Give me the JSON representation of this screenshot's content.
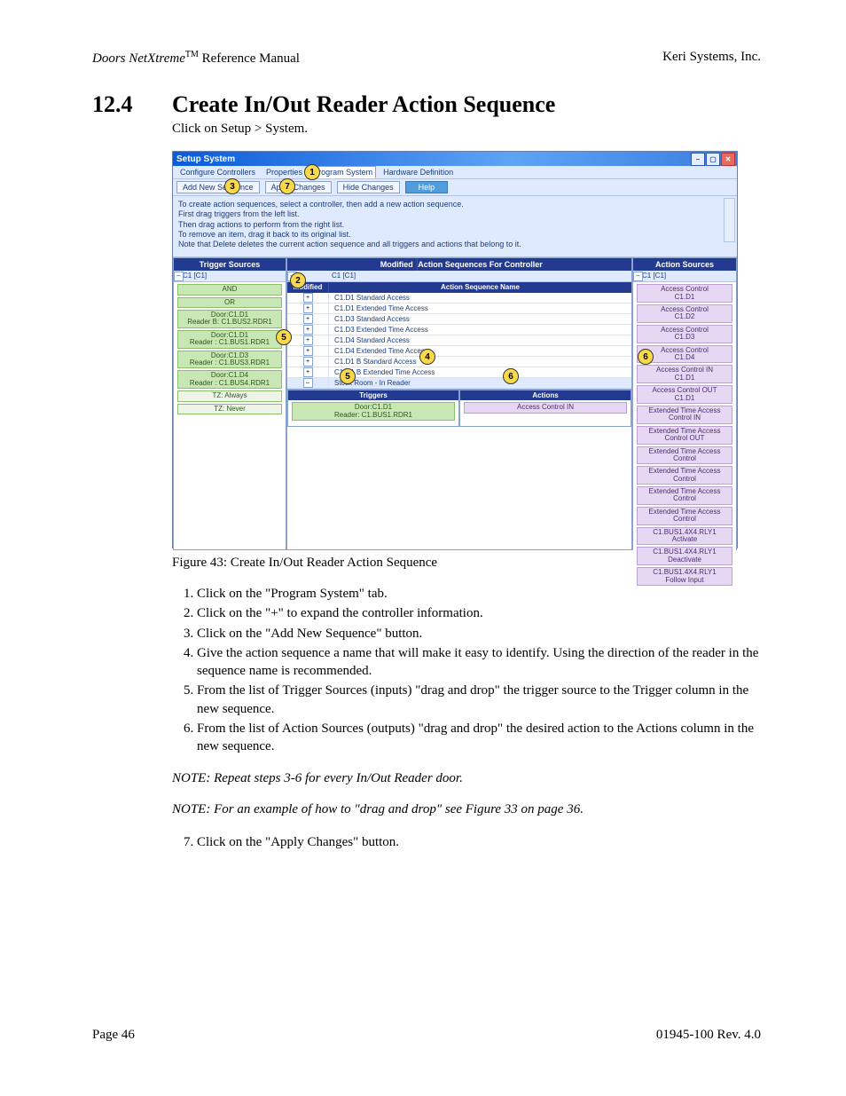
{
  "header": {
    "left_product": "Doors NetXtreme",
    "left_tm": "TM",
    "left_rest": " Reference Manual",
    "right": "Keri Systems, Inc."
  },
  "h1": {
    "num": "12.4",
    "title": "Create In/Out Reader Action Sequence"
  },
  "intro": "Click on Setup > System.",
  "fig": {
    "caption": "Figure 43: Create In/Out Reader Action Sequence"
  },
  "steps": [
    "Click on the \"Program System\" tab.",
    "Click on the \"+\" to expand the controller information.",
    "Click on the \"Add New Sequence\" button.",
    "Give the action sequence a name that will make it easy to identify. Using the direction of the reader in the sequence name is recommended.",
    "From the list of Trigger Sources (inputs) \"drag and drop\" the trigger source to the Trigger column in the new sequence.",
    "From the list of Action Sources (outputs) \"drag and drop\" the desired action to the Actions column in the new sequence."
  ],
  "note1": "NOTE: Repeat steps 3-6 for every In/Out Reader door.",
  "note2": "NOTE: For an example of how to \"drag and drop\" see Figure 33 on page 36.",
  "step7": "Click on the \"Apply Changes\" button.",
  "footer": {
    "left": "Page 46",
    "right": "01945-100  Rev. 4.0"
  },
  "shot": {
    "title": "Setup System",
    "tabs": [
      "Configure Controllers",
      "Properties",
      "Program System",
      "Hardware Definition"
    ],
    "toolbar": {
      "add": "Add New Sequence",
      "apply": "Apply Changes",
      "hide": "Hide Changes",
      "help": "Help"
    },
    "help": [
      "To create action sequences, select a controller, then add a new action sequence.",
      "First drag triggers from the left list.",
      "Then drag actions to perform from the right list.",
      "To remove an item, drag it back to its original list.",
      "Note that Delete deletes the current action sequence and all triggers and actions that belong to it."
    ],
    "left": {
      "head": "Trigger Sources",
      "ctl": "C1 [C1]",
      "items": [
        "AND",
        "OR",
        "Door:C1.D1\nReader B: C1.BUS2.RDR1",
        "Door:C1.D1\nReader : C1.BUS1.RDR1",
        "Door:C1.D3\nReader : C1.BUS3.RDR1",
        "Door:C1.D4\nReader : C1.BUS4.RDR1",
        "TZ: Always",
        "TZ: Never"
      ]
    },
    "mid": {
      "head": "Action Sequences For Controller",
      "ctl": "C1 [C1]",
      "cols": {
        "m": "Modified",
        "r": "Action Sequence Name"
      },
      "rows": [
        "C1.D1 Standard Access",
        "C1.D1 Extended Time Access",
        "C1.D3 Standard Access",
        "C1.D3 Extended Time Access",
        "C1.D4 Standard Access",
        "C1.D4 Extended Time Access",
        "C1.D1 B Standard Access",
        "C1.D1 B Extended Time Access",
        "Stock Room - In Reader"
      ],
      "sub": {
        "t": "Triggers",
        "a": "Actions",
        "titm": "Door:C1.D1\nReader: C1.BUS1.RDR1",
        "aitm": "Access Control IN"
      }
    },
    "right": {
      "head": "Action Sources",
      "ctl": "C1 [C1]",
      "items": [
        "Access Control\nC1.D1",
        "Access Control\nC1.D2",
        "Access Control\nC1.D3",
        "Access Control\nC1.D4",
        "Access Control IN\nC1.D1",
        "Access Control OUT\nC1.D1",
        "Extended Time Access\nControl IN",
        "Extended Time Access\nControl OUT",
        "Extended Time Access\nControl",
        "Extended Time Access\nControl",
        "Extended Time Access\nControl",
        "Extended Time Access\nControl",
        "C1.BUS1.4X4.RLY1\nActivate",
        "C1.BUS1.4X4.RLY1\nDeactivate",
        "C1.BUS1.4X4.RLY1\nFollow Input"
      ]
    }
  },
  "callouts": {
    "c1": "1",
    "c2": "2",
    "c3": "3",
    "c4": "4",
    "c5": "5",
    "c6": "6",
    "c7": "7",
    "c5b": "5",
    "c6b": "6"
  }
}
